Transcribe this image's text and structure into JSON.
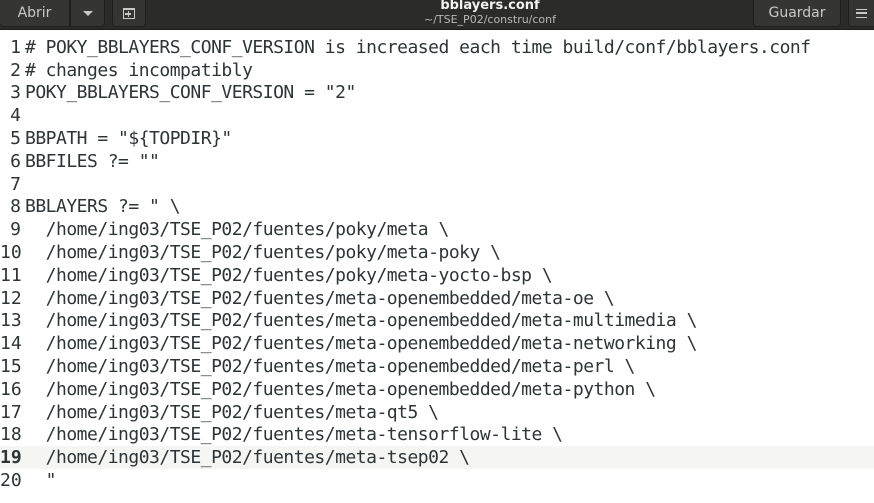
{
  "header": {
    "open_label": "Abrir",
    "save_label": "Guardar",
    "title": "bblayers.conf",
    "subtitle": "~/TSE_P02/constru/conf"
  },
  "icons": {
    "open_menu": "chevron-down-icon",
    "new_tab": "new-tab-icon",
    "main_menu": "hamburger-menu-icon"
  },
  "editor": {
    "current_line": 19,
    "lines": [
      {
        "num": "1",
        "text": "# POKY_BBLAYERS_CONF_VERSION is increased each time build/conf/bblayers.conf"
      },
      {
        "num": "2",
        "text": "# changes incompatibly"
      },
      {
        "num": "3",
        "text": "POKY_BBLAYERS_CONF_VERSION = \"2\""
      },
      {
        "num": "4",
        "text": ""
      },
      {
        "num": "5",
        "text": "BBPATH = \"${TOPDIR}\""
      },
      {
        "num": "6",
        "text": "BBFILES ?= \"\""
      },
      {
        "num": "7",
        "text": ""
      },
      {
        "num": "8",
        "text": "BBLAYERS ?= \" \\"
      },
      {
        "num": "9",
        "text": "  /home/ing03/TSE_P02/fuentes/poky/meta \\"
      },
      {
        "num": "10",
        "text": "  /home/ing03/TSE_P02/fuentes/poky/meta-poky \\"
      },
      {
        "num": "11",
        "text": "  /home/ing03/TSE_P02/fuentes/poky/meta-yocto-bsp \\"
      },
      {
        "num": "12",
        "text": "  /home/ing03/TSE_P02/fuentes/meta-openembedded/meta-oe \\"
      },
      {
        "num": "13",
        "text": "  /home/ing03/TSE_P02/fuentes/meta-openembedded/meta-multimedia \\"
      },
      {
        "num": "14",
        "text": "  /home/ing03/TSE_P02/fuentes/meta-openembedded/meta-networking \\"
      },
      {
        "num": "15",
        "text": "  /home/ing03/TSE_P02/fuentes/meta-openembedded/meta-perl \\"
      },
      {
        "num": "16",
        "text": "  /home/ing03/TSE_P02/fuentes/meta-openembedded/meta-python \\"
      },
      {
        "num": "17",
        "text": "  /home/ing03/TSE_P02/fuentes/meta-qt5 \\"
      },
      {
        "num": "18",
        "text": "  /home/ing03/TSE_P02/fuentes/meta-tensorflow-lite \\"
      },
      {
        "num": "19",
        "text": "  /home/ing03/TSE_P02/fuentes/meta-tsep02 \\"
      },
      {
        "num": "20",
        "text": "  \""
      }
    ]
  }
}
